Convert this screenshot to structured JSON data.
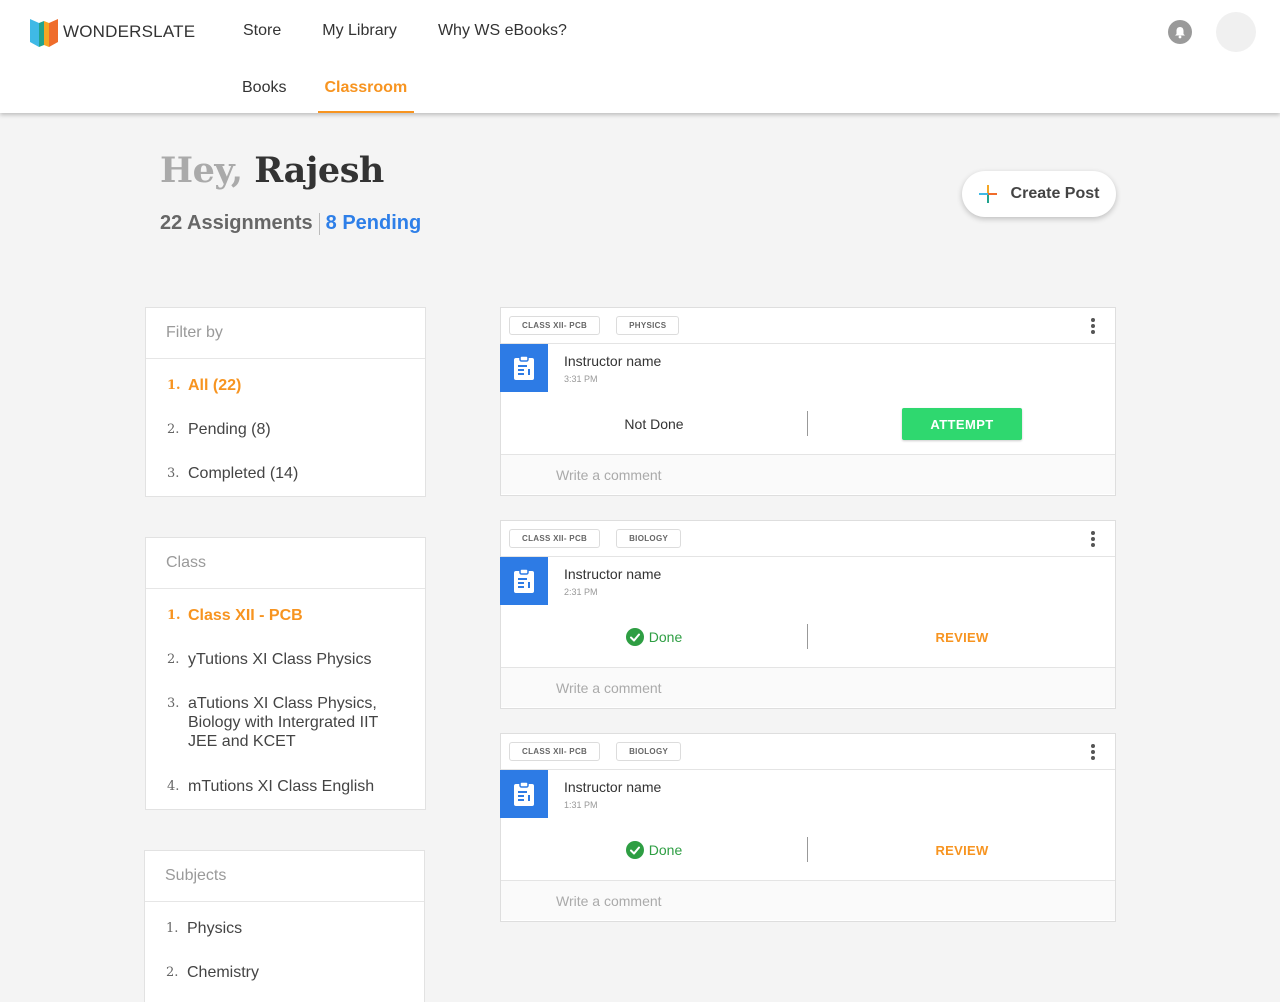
{
  "brand": {
    "name": "WONDERSLATE"
  },
  "topnav": [
    "Store",
    "My Library",
    "Why WS eBooks?"
  ],
  "subnav": {
    "books": "Books",
    "classroom": "Classroom"
  },
  "greeting": {
    "hey": "Hey,",
    "name": "Rajesh"
  },
  "stats": {
    "assignments": "22 Assignments",
    "pending": "8 Pending"
  },
  "create_post": "Create Post",
  "filter": {
    "title": "Filter by",
    "items": [
      {
        "num": "1.",
        "label": "All (22)"
      },
      {
        "num": "2.",
        "label": "Pending (8)"
      },
      {
        "num": "3.",
        "label": "Completed (14)"
      }
    ]
  },
  "class_panel": {
    "title": "Class",
    "items": [
      {
        "num": "1.",
        "label": "Class XII - PCB"
      },
      {
        "num": "2.",
        "label": "yTutions XI Class Physics"
      },
      {
        "num": "3.",
        "label": "aTutions XI Class Physics, Biology with Intergrated IIT JEE and KCET"
      },
      {
        "num": "4.",
        "label": "mTutions XI Class English"
      }
    ]
  },
  "subjects_panel": {
    "title": "Subjects",
    "items": [
      {
        "num": "1.",
        "label": "Physics"
      },
      {
        "num": "2.",
        "label": "Chemistry"
      }
    ]
  },
  "cards": [
    {
      "class_tag": "CLASS XII- PCB",
      "subject_tag": "PHYSICS",
      "instructor": "Instructor name",
      "time": "3:31 PM",
      "status": "Not Done",
      "action": "ATTEMPT",
      "comment_placeholder": "Write a comment"
    },
    {
      "class_tag": "CLASS XII- PCB",
      "subject_tag": "BIOLOGY",
      "instructor": "Instructor name",
      "time": "2:31 PM",
      "status": "Done",
      "action": "REVIEW",
      "comment_placeholder": "Write a comment"
    },
    {
      "class_tag": "CLASS XII- PCB",
      "subject_tag": "BIOLOGY",
      "instructor": "Instructor name",
      "time": "1:31 PM",
      "status": "Done",
      "action": "REVIEW",
      "comment_placeholder": "Write a comment"
    }
  ],
  "colors": {
    "accent": "#f79420",
    "blue": "#2e7fe8",
    "green": "#2fd86f",
    "icon_blue": "#2d7be5"
  }
}
